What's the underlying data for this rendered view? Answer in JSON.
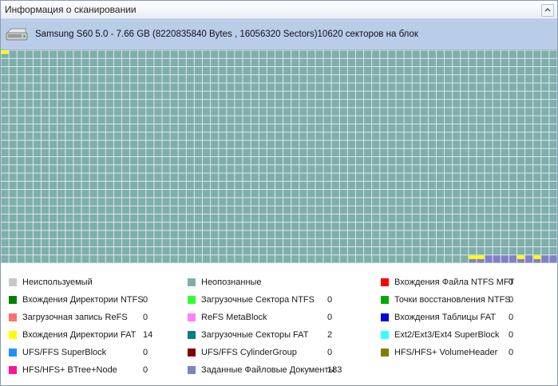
{
  "window": {
    "title": "Информация о сканировании"
  },
  "disk": {
    "info": "Samsung S60 5.0 - 7.66 GB (8220835840 Bytes , 16056320 Sectors)10620 секторов на блок"
  },
  "colors": {
    "unrecognized": "#7fafab",
    "grid_line": "#ffffff",
    "fat_dir": "#ffff00",
    "user_docs": "#8080c8"
  },
  "map": {
    "rows": 26,
    "cols": 69,
    "blocks": [
      {
        "row": 0,
        "col": 0,
        "kind": "fat_dir"
      },
      {
        "row": 25,
        "col": 58,
        "kind": "fat_dir"
      },
      {
        "row": 25,
        "col": 59,
        "kind": "fat_dir"
      },
      {
        "row": 25,
        "col": 60,
        "kind": "user_docs"
      },
      {
        "row": 25,
        "col": 61,
        "kind": "user_docs"
      },
      {
        "row": 25,
        "col": 62,
        "kind": "user_docs"
      },
      {
        "row": 25,
        "col": 63,
        "kind": "user_docs"
      },
      {
        "row": 25,
        "col": 64,
        "kind": "fat_dir"
      },
      {
        "row": 25,
        "col": 65,
        "kind": "user_docs"
      },
      {
        "row": 25,
        "col": 66,
        "kind": "fat_dir"
      },
      {
        "row": 25,
        "col": 67,
        "kind": "user_docs"
      },
      {
        "row": 25,
        "col": 68,
        "kind": "user_docs"
      }
    ]
  },
  "legend": [
    {
      "label": "Неиспользуемый",
      "count": "",
      "color": "#c8c8c8"
    },
    {
      "label": "Неопознанные",
      "count": "",
      "color": "#7fafab"
    },
    {
      "label": "Вхождения Файла NTFS MFT",
      "count": "0",
      "color": "#ff0000"
    },
    {
      "label": "Вхождения Директории NTFS",
      "count": "0",
      "color": "#008000"
    },
    {
      "label": "Загрузочные Сектора NTFS",
      "count": "0",
      "color": "#33ff33"
    },
    {
      "label": "Точки восстановления NTFS",
      "count": "0",
      "color": "#00aa00"
    },
    {
      "label": "Загрузочная запись ReFS",
      "count": "0",
      "color": "#ff7070"
    },
    {
      "label": "ReFS MetaBlock",
      "count": "0",
      "color": "#ff80ff"
    },
    {
      "label": "Вхождения Таблицы FAT",
      "count": "0",
      "color": "#0000e0"
    },
    {
      "label": "Вхождения Директории FAT",
      "count": "14",
      "color": "#ffff00"
    },
    {
      "label": "Загрузочные Секторы FAT",
      "count": "2",
      "color": "#008080"
    },
    {
      "label": "Ext2/Ext3/Ext4 SuperBlock",
      "count": "0",
      "color": "#33ffff"
    },
    {
      "label": "UFS/FFS SuperBlock",
      "count": "0",
      "color": "#1e90ff"
    },
    {
      "label": "UFS/FFS CylinderGroup",
      "count": "0",
      "color": "#800000"
    },
    {
      "label": "HFS/HFS+ VolumeHeader",
      "count": "0",
      "color": "#808000"
    },
    {
      "label": "HFS/HFS+ BTree+Node",
      "count": "0",
      "color": "#ff1493"
    },
    {
      "label": "Заданные Файловые Документы",
      "count": "183",
      "color": "#8080c8"
    }
  ]
}
